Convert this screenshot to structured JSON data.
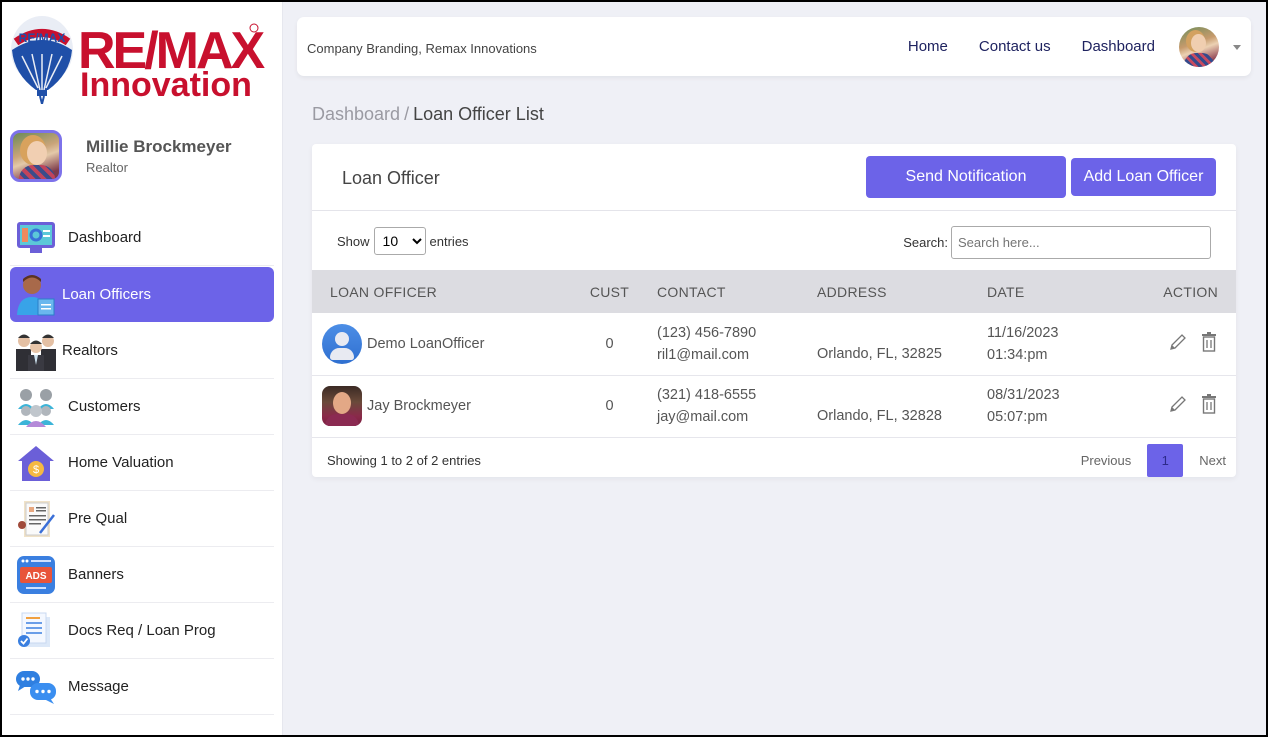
{
  "logo": {
    "brand_top": "RE/MAX",
    "brand_bottom": "Innovation",
    "balloon_text": "RE/MAX"
  },
  "profile": {
    "name": "Millie Brockmeyer",
    "role": "Realtor"
  },
  "sidebar": {
    "items": [
      {
        "label": "Dashboard",
        "icon": "monitor-dashboard-icon",
        "active": false
      },
      {
        "label": "Loan Officers",
        "icon": "loan-officer-icon",
        "active": true
      },
      {
        "label": "Realtors",
        "icon": "realtors-group-icon",
        "active": false
      },
      {
        "label": "Customers",
        "icon": "customers-group-icon",
        "active": false
      },
      {
        "label": "Home Valuation",
        "icon": "house-dollar-icon",
        "active": false
      },
      {
        "label": "Pre Qual",
        "icon": "document-sign-icon",
        "active": false
      },
      {
        "label": "Banners",
        "icon": "ads-banner-icon",
        "active": false
      },
      {
        "label": "Docs Req / Loan Prog",
        "icon": "documents-check-icon",
        "active": false
      },
      {
        "label": "Message",
        "icon": "chat-bubbles-icon",
        "active": false
      }
    ]
  },
  "topbar": {
    "brand_text": "Company Branding, Remax Innovations",
    "links": [
      "Home",
      "Contact us",
      "Dashboard"
    ]
  },
  "breadcrumb": {
    "parent": "Dashboard",
    "separator": "/",
    "current": "Loan Officer List"
  },
  "card": {
    "title": "Loan Officer",
    "send_notification_label": "Send Notification",
    "add_label": "Add Loan Officer",
    "show_label": "Show",
    "entries_label": "entries",
    "page_size": "10",
    "search_label": "Search:",
    "search_placeholder": "Search here...",
    "search_value": ""
  },
  "table": {
    "columns": [
      "LOAN OFFICER",
      "CUST",
      "CONTACT",
      "ADDRESS",
      "DATE",
      "ACTION"
    ],
    "rows": [
      {
        "name": "Demo LoanOfficer",
        "avatar": "generic-user",
        "cust": "0",
        "phone": "(123) 456-7890",
        "email": "ril1@mail.com",
        "address": "Orlando, FL, 32825",
        "date": "11/16/2023",
        "time": "01:34:pm"
      },
      {
        "name": "Jay Brockmeyer",
        "avatar": "photo",
        "cust": "0",
        "phone": "(321) 418-6555",
        "email": "jay@mail.com",
        "address": "Orlando, FL, 32828",
        "date": "08/31/2023",
        "time": "05:07:pm"
      }
    ]
  },
  "footer": {
    "showing_text": "Showing 1 to 2 of 2 entries",
    "previous_label": "Previous",
    "current_page": "1",
    "next_label": "Next"
  },
  "colors": {
    "accent": "#6c63e8",
    "brand_red": "#c8102e",
    "brand_blue": "#003da5",
    "page_bg": "#eff0f6",
    "table_header_bg": "#dcdce1"
  }
}
